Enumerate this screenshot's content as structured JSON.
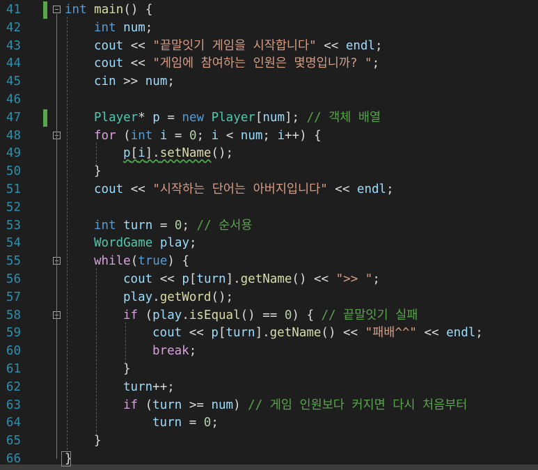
{
  "editor": {
    "lines": [
      {
        "n": "41",
        "tokens": [
          [
            "kw",
            "int"
          ],
          [
            "pl",
            " "
          ],
          [
            "fn",
            "main"
          ],
          [
            "pl",
            "() {"
          ]
        ]
      },
      {
        "n": "42",
        "tokens": [
          [
            "kw",
            "int"
          ],
          [
            "pl",
            " "
          ],
          [
            "var",
            "num"
          ],
          [
            "pl",
            ";"
          ]
        ]
      },
      {
        "n": "43",
        "tokens": [
          [
            "var",
            "cout"
          ],
          [
            "pl",
            " << "
          ],
          [
            "str",
            "\"끝말잇기 게임을 시작합니다\""
          ],
          [
            "pl",
            " << "
          ],
          [
            "var",
            "endl"
          ],
          [
            "pl",
            ";"
          ]
        ]
      },
      {
        "n": "44",
        "tokens": [
          [
            "var",
            "cout"
          ],
          [
            "pl",
            " << "
          ],
          [
            "str",
            "\"게임에 참여하는 인원은 몇명입니까? \""
          ],
          [
            "pl",
            ";"
          ]
        ]
      },
      {
        "n": "45",
        "tokens": [
          [
            "var",
            "cin"
          ],
          [
            "pl",
            " >> "
          ],
          [
            "var",
            "num"
          ],
          [
            "pl",
            ";"
          ]
        ]
      },
      {
        "n": "46",
        "tokens": []
      },
      {
        "n": "47",
        "tokens": [
          [
            "ty",
            "Player"
          ],
          [
            "pl",
            "* "
          ],
          [
            "var",
            "p"
          ],
          [
            "pl",
            " = "
          ],
          [
            "kw",
            "new"
          ],
          [
            "pl",
            " "
          ],
          [
            "ty",
            "Player"
          ],
          [
            "pl",
            "["
          ],
          [
            "var",
            "num"
          ],
          [
            "pl",
            "]; "
          ],
          [
            "cm",
            "// 객체 배열"
          ]
        ]
      },
      {
        "n": "48",
        "tokens": [
          [
            "ctl",
            "for"
          ],
          [
            "pl",
            " ("
          ],
          [
            "kw",
            "int"
          ],
          [
            "pl",
            " "
          ],
          [
            "var",
            "i"
          ],
          [
            "pl",
            " = "
          ],
          [
            "num",
            "0"
          ],
          [
            "pl",
            "; "
          ],
          [
            "var",
            "i"
          ],
          [
            "pl",
            " < "
          ],
          [
            "var",
            "num"
          ],
          [
            "pl",
            "; "
          ],
          [
            "var",
            "i"
          ],
          [
            "pl",
            "++) {"
          ]
        ]
      },
      {
        "n": "49",
        "tokens": [
          [
            "var",
            "p"
          ],
          [
            "pl",
            "["
          ],
          [
            "var",
            "i"
          ],
          [
            "pl",
            "]."
          ],
          [
            "fn",
            "setName"
          ],
          [
            "pl",
            "();"
          ]
        ]
      },
      {
        "n": "50",
        "tokens": [
          [
            "pl",
            "}"
          ]
        ]
      },
      {
        "n": "51",
        "tokens": [
          [
            "var",
            "cout"
          ],
          [
            "pl",
            " << "
          ],
          [
            "str",
            "\"시작하는 단어는 아버지입니다\""
          ],
          [
            "pl",
            " << "
          ],
          [
            "var",
            "endl"
          ],
          [
            "pl",
            ";"
          ]
        ]
      },
      {
        "n": "52",
        "tokens": []
      },
      {
        "n": "53",
        "tokens": [
          [
            "kw",
            "int"
          ],
          [
            "pl",
            " "
          ],
          [
            "var",
            "turn"
          ],
          [
            "pl",
            " = "
          ],
          [
            "num",
            "0"
          ],
          [
            "pl",
            "; "
          ],
          [
            "cm",
            "// 순서용"
          ]
        ]
      },
      {
        "n": "54",
        "tokens": [
          [
            "ty",
            "WordGame"
          ],
          [
            "pl",
            " "
          ],
          [
            "var",
            "play"
          ],
          [
            "pl",
            ";"
          ]
        ]
      },
      {
        "n": "55",
        "tokens": [
          [
            "ctl",
            "while"
          ],
          [
            "pl",
            "("
          ],
          [
            "kw",
            "true"
          ],
          [
            "pl",
            ") {"
          ]
        ]
      },
      {
        "n": "56",
        "tokens": [
          [
            "var",
            "cout"
          ],
          [
            "pl",
            " << "
          ],
          [
            "var",
            "p"
          ],
          [
            "pl",
            "["
          ],
          [
            "var",
            "turn"
          ],
          [
            "pl",
            "]."
          ],
          [
            "fn",
            "getName"
          ],
          [
            "pl",
            "() << "
          ],
          [
            "str",
            "\">> \""
          ],
          [
            "pl",
            ";"
          ]
        ]
      },
      {
        "n": "57",
        "tokens": [
          [
            "var",
            "play"
          ],
          [
            "pl",
            "."
          ],
          [
            "fn",
            "getWord"
          ],
          [
            "pl",
            "();"
          ]
        ]
      },
      {
        "n": "58",
        "tokens": [
          [
            "ctl",
            "if"
          ],
          [
            "pl",
            " ("
          ],
          [
            "var",
            "play"
          ],
          [
            "pl",
            "."
          ],
          [
            "fn",
            "isEqual"
          ],
          [
            "pl",
            "() == "
          ],
          [
            "num",
            "0"
          ],
          [
            "pl",
            ") { "
          ],
          [
            "cm",
            "// 끝말잇기 실패"
          ]
        ]
      },
      {
        "n": "59",
        "tokens": [
          [
            "var",
            "cout"
          ],
          [
            "pl",
            " << "
          ],
          [
            "var",
            "p"
          ],
          [
            "pl",
            "["
          ],
          [
            "var",
            "turn"
          ],
          [
            "pl",
            "]."
          ],
          [
            "fn",
            "getName"
          ],
          [
            "pl",
            "() << "
          ],
          [
            "str",
            "\"패배^^\""
          ],
          [
            "pl",
            " << "
          ],
          [
            "var",
            "endl"
          ],
          [
            "pl",
            ";"
          ]
        ]
      },
      {
        "n": "60",
        "tokens": [
          [
            "ctl",
            "break"
          ],
          [
            "pl",
            ";"
          ]
        ]
      },
      {
        "n": "61",
        "tokens": [
          [
            "pl",
            "}"
          ]
        ]
      },
      {
        "n": "62",
        "tokens": [
          [
            "var",
            "turn"
          ],
          [
            "pl",
            "++;"
          ]
        ]
      },
      {
        "n": "63",
        "tokens": [
          [
            "ctl",
            "if"
          ],
          [
            "pl",
            " ("
          ],
          [
            "var",
            "turn"
          ],
          [
            "pl",
            " >= "
          ],
          [
            "var",
            "num"
          ],
          [
            "pl",
            ") "
          ],
          [
            "cm",
            "// 게임 인원보다 커지면 다시 처음부터"
          ]
        ]
      },
      {
        "n": "64",
        "tokens": [
          [
            "var",
            "turn"
          ],
          [
            "pl",
            " = "
          ],
          [
            "num",
            "0"
          ],
          [
            "pl",
            ";"
          ]
        ]
      },
      {
        "n": "65",
        "tokens": [
          [
            "pl",
            "}"
          ]
        ]
      },
      {
        "n": "66",
        "tokens": [
          [
            "pl",
            "}"
          ]
        ]
      }
    ]
  }
}
